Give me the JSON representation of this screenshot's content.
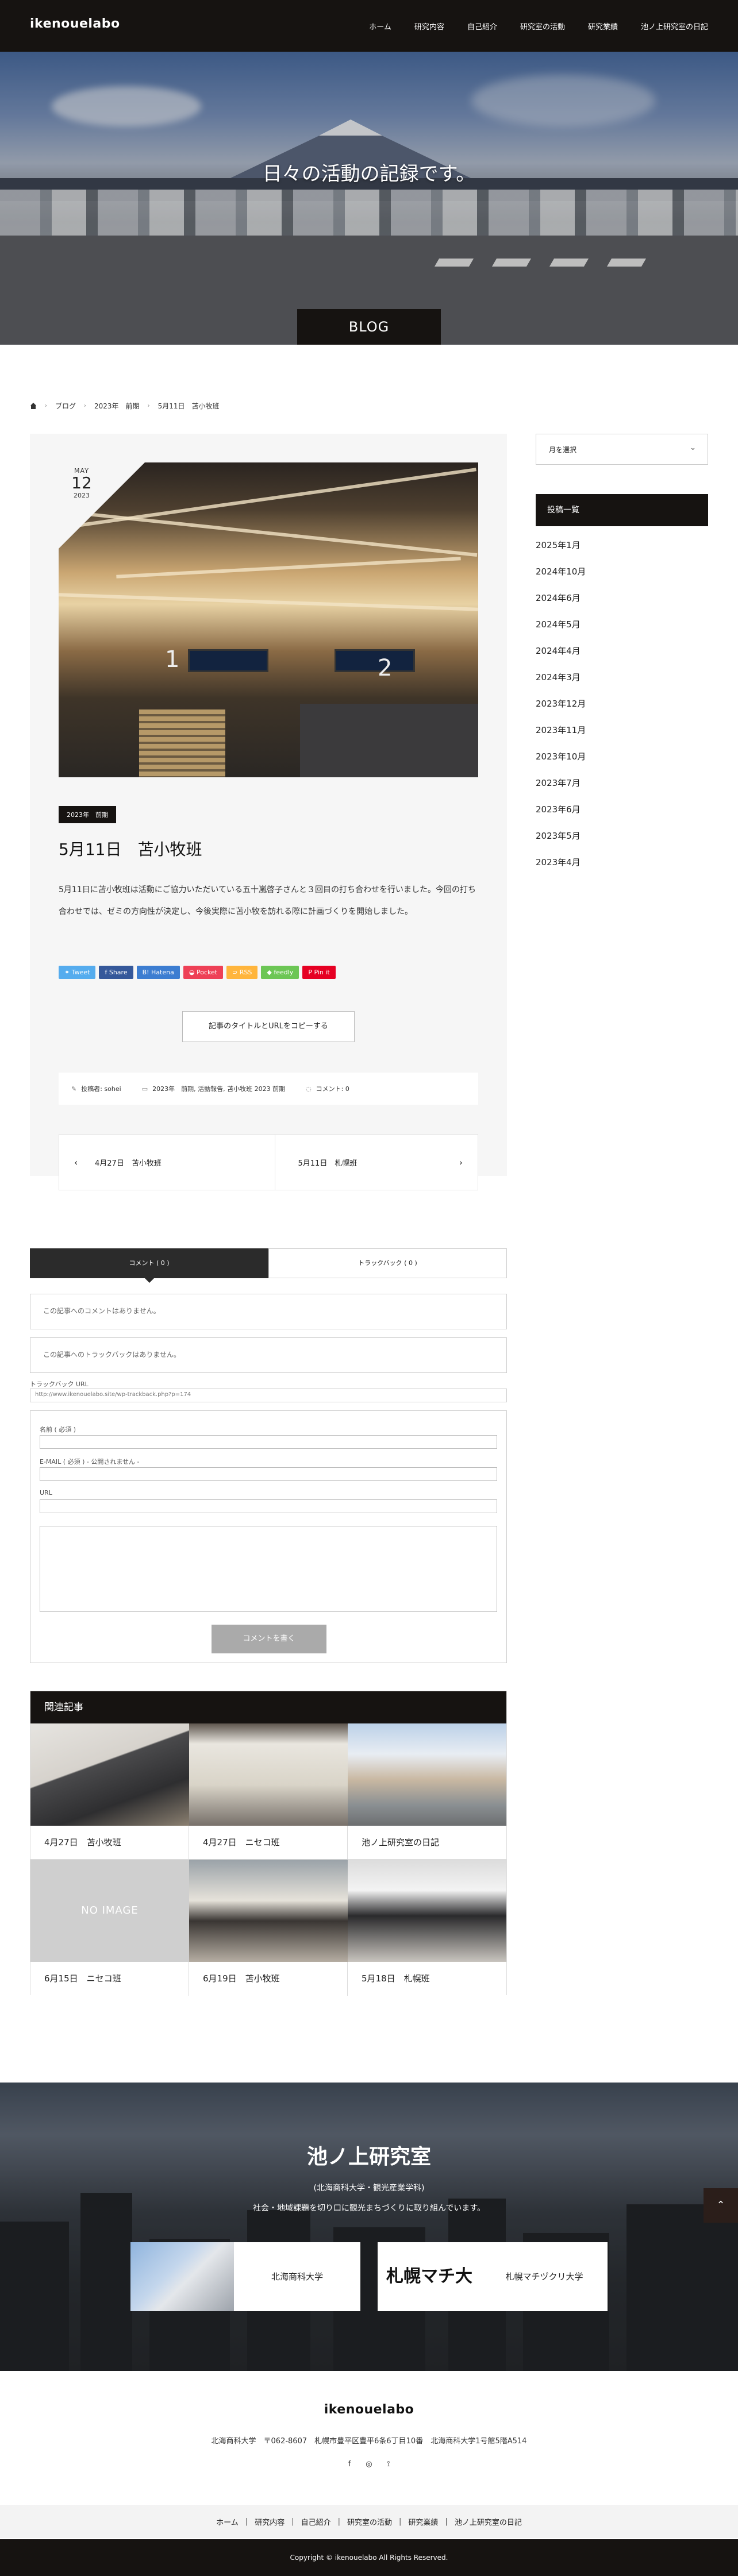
{
  "header": {
    "logo": "ikenouelabo",
    "nav": [
      "ホーム",
      "研究内容",
      "自己紹介",
      "研究室の活動",
      "研究業績",
      "池ノ上研究室の日記"
    ]
  },
  "hero": {
    "tagline": "日々の活動の記録です。",
    "badge": "BLOG"
  },
  "breadcrumb": [
    "ブログ",
    "2023年　前期",
    "5月11日　苫小牧班"
  ],
  "post": {
    "date_month": "MAY",
    "date_day": "12",
    "date_year": "2023",
    "category": "2023年　前期",
    "title": "5月11日　苫小牧班",
    "body": "5月11日に苫小牧班は活動にご協力いただいている五十嵐啓子さんと３回目の打ち合わせを行いました。今回の打ち合わせでは、ゼミの方向性が決定し、今後実際に苫小牧を訪れる際に計画づくりを開始しました。",
    "share": [
      {
        "label": "Tweet",
        "color": "#55acee"
      },
      {
        "label": "Share",
        "color": "#35589a"
      },
      {
        "label": "Hatena",
        "color": "#3c7dd1"
      },
      {
        "label": "Pocket",
        "color": "#ee4056"
      },
      {
        "label": "RSS",
        "color": "#ffb53c"
      },
      {
        "label": "feedly",
        "color": "#6cc655"
      },
      {
        "label": "Pin it",
        "color": "#e60023"
      }
    ],
    "copy_button": "記事のタイトルとURLをコピーする",
    "meta_author": "投稿者: sohei",
    "meta_categories": "2023年　前期, 活動報告, 苫小牧班 2023 前期",
    "meta_comments": "コメント: 0",
    "prev": "4月27日　苫小牧班",
    "next": "5月11日　札幌班"
  },
  "comments": {
    "tab_comments": "コメント ( 0 )",
    "tab_trackbacks": "トラックバック ( 0 )",
    "no_comments": "この記事へのコメントはありません。",
    "no_trackbacks": "この記事へのトラックバックはありません。",
    "trackback_label": "トラックバック URL",
    "trackback_url": "http://www.ikenouelabo.site/wp-trackback.php?p=174",
    "name_label": "名前 ( 必須 )",
    "email_label": "E-MAIL ( 必須 ) - 公開されません -",
    "url_label": "URL",
    "submit": "コメントを書く"
  },
  "related": {
    "heading": "関連記事",
    "items": [
      {
        "title": "4月27日　苫小牧班"
      },
      {
        "title": "4月27日　ニセコ班"
      },
      {
        "title": "池ノ上研究室の日記"
      },
      {
        "title": "6月15日　ニセコ班",
        "placeholder": "NO IMAGE"
      },
      {
        "title": "6月19日　苫小牧班"
      },
      {
        "title": "5月18日　札幌班"
      }
    ]
  },
  "sidebar": {
    "select": "月を選択",
    "archive_heading": "投稿一覧",
    "archives": [
      "2025年1月",
      "2024年10月",
      "2024年6月",
      "2024年5月",
      "2024年4月",
      "2024年3月",
      "2023年12月",
      "2023年11月",
      "2023年10月",
      "2023年7月",
      "2023年6月",
      "2023年5月",
      "2023年4月"
    ]
  },
  "footer": {
    "lab_title": "池ノ上研究室",
    "lab_sub": "(北海商科大学・観光産業学科)",
    "lab_sub2": "社会・地域課題を切り口に観光まちづくりに取り組んでいます。",
    "link1": "北海商科大学",
    "link2": "札幌マチヅクリ大学",
    "link2_logo": "札幌マチ大",
    "site_name": "ikenouelabo",
    "address": "北海商科大学　〒062-8607　札幌市豊平区豊平6条6丁目10番　北海商科大学1号館5階A514",
    "social": [
      "f",
      "◎",
      "⟟"
    ],
    "nav": [
      "ホーム",
      "研究内容",
      "自己紹介",
      "研究室の活動",
      "研究業績",
      "池ノ上研究室の日記"
    ],
    "copyright": "Copyright © ikenouelabo All Rights Reserved."
  }
}
